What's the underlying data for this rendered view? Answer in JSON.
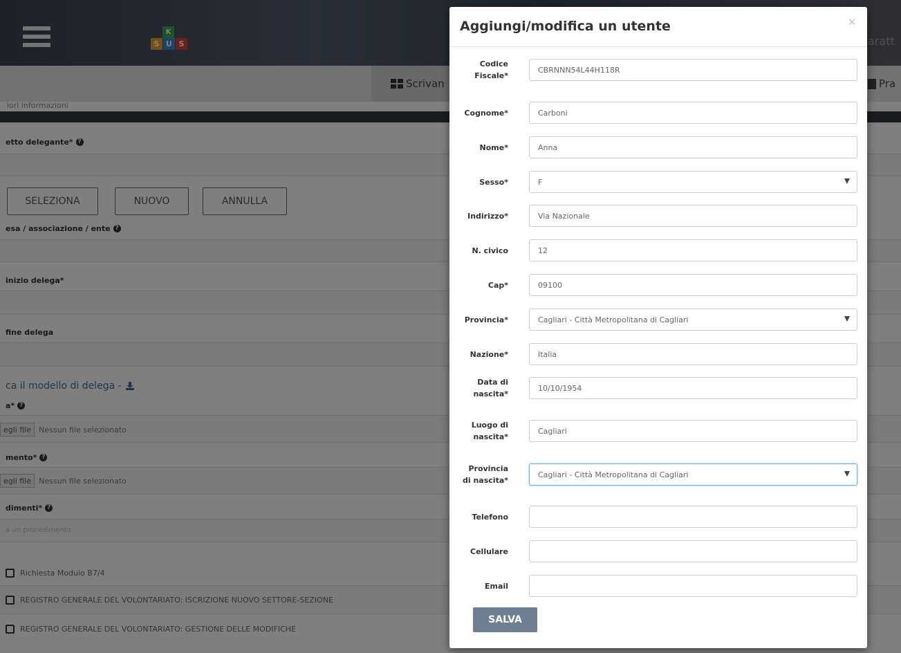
{
  "background": {
    "logo_letters": [
      "S",
      "U",
      "S"
    ],
    "logo_top_letter": "K",
    "header_right_text": "aratt",
    "nav_tab_label": "Scrivan",
    "nav_right_label": "Pra",
    "subtext": "iori informazioni",
    "labels": {
      "delegante": "etto delegante*",
      "impresa": "esa / associazione / ente",
      "inizio": "inizio delega*",
      "fine": "fine delega",
      "download_link": "ca il modello di delega - ",
      "delega_file": "a*",
      "documento": "mento*",
      "procedimenti": "dimenti*"
    },
    "buttons": {
      "seleziona": "SELEZIONA",
      "nuovo": "NUOVO",
      "annulla": "ANNULLA"
    },
    "file_rows": [
      {
        "button": "egli file",
        "status": "Nessun file selezionato"
      },
      {
        "button": "egli file",
        "status": "Nessun file selezionato"
      }
    ],
    "procedimenti_placeholder": "a un procedimento",
    "checkbox_items": [
      "Richiesta Modulo B7/4",
      "REGISTRO GENERALE DEL VOLONTARIATO: ISCRIZIONE NUOVO SETTORE-SEZIONE",
      "REGISTRO GENERALE DEL VOLONTARIATO: GESTIONE DELLE MODIFICHE"
    ]
  },
  "modal": {
    "title": "Aggiungi/modifica un utente",
    "close": "×",
    "fields": [
      {
        "label": [
          "Codice",
          "Fiscale*"
        ],
        "value": "CBRNNN54L44H118R",
        "type": "text"
      },
      {
        "label": [
          "Cognome*"
        ],
        "value": "Carboni",
        "type": "text"
      },
      {
        "label": [
          "Nome*"
        ],
        "value": "Anna",
        "type": "text"
      },
      {
        "label": [
          "Sesso*"
        ],
        "value": "F",
        "type": "select"
      },
      {
        "label": [
          "Indirizzo*"
        ],
        "value": "Via Nazionale",
        "type": "text"
      },
      {
        "label": [
          "N. civico"
        ],
        "value": "12",
        "type": "text"
      },
      {
        "label": [
          "Cap*"
        ],
        "value": "09100",
        "type": "text"
      },
      {
        "label": [
          "Provincia*"
        ],
        "value": "Cagliari - Città Metropolitana di Cagliari",
        "type": "select"
      },
      {
        "label": [
          "Nazione*"
        ],
        "value": "Italia",
        "type": "text"
      },
      {
        "label": [
          "Data di",
          "nascita*"
        ],
        "value": "10/10/1954",
        "type": "text"
      },
      {
        "label": [
          "Luogo di",
          "nascita*"
        ],
        "value": "Cagliari",
        "type": "text"
      },
      {
        "label": [
          "Provincia",
          "di nascita*"
        ],
        "value": "Cagliari - Città Metropolitana di Cagliari",
        "type": "select"
      },
      {
        "label": [
          "Telefono"
        ],
        "value": "",
        "type": "text"
      },
      {
        "label": [
          "Cellulare"
        ],
        "value": "",
        "type": "text"
      },
      {
        "label": [
          "Email"
        ],
        "value": "",
        "type": "text"
      }
    ],
    "save_label": "SALVA"
  },
  "colors": {
    "save_button": "#6e7f93",
    "link": "#3f6c9e",
    "focus_border": "#66afe9"
  }
}
